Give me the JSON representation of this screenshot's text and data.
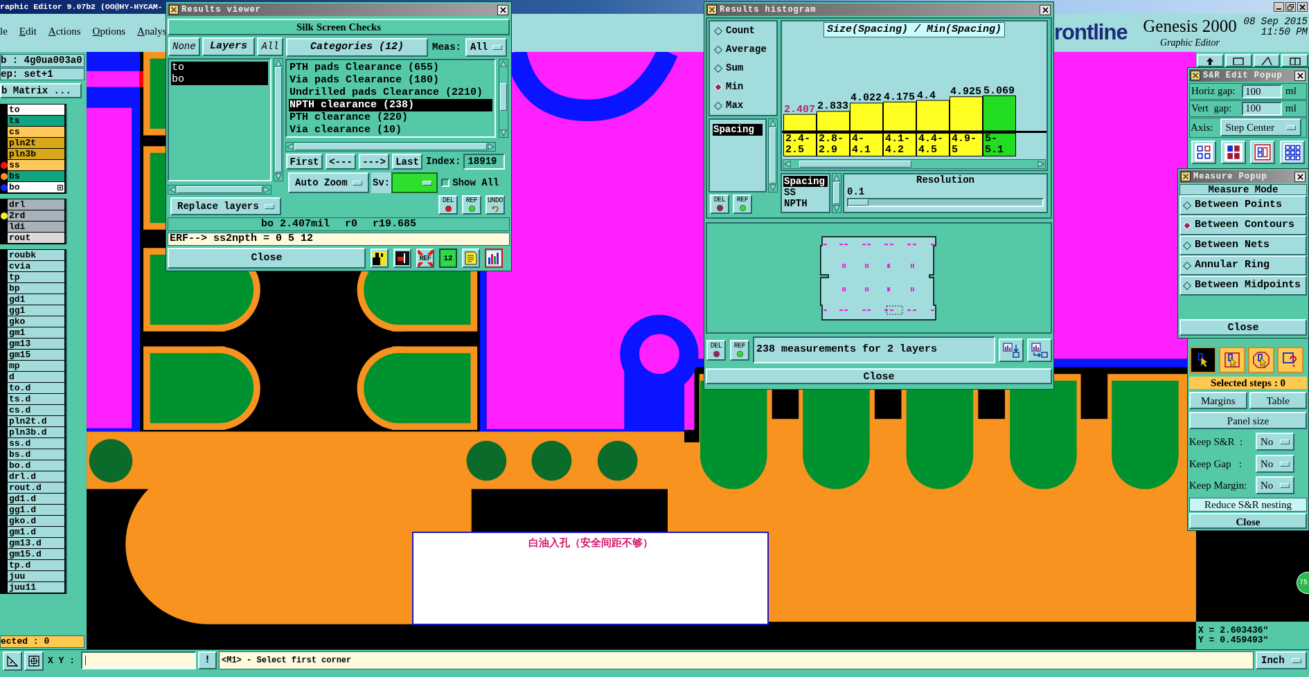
{
  "main_window": {
    "title": "raphic Editor 9.07b2 (OO@HY-HYCAM-",
    "menu": [
      {
        "label": "le",
        "mnemonic": false
      },
      {
        "label": "Edit",
        "mnemonic": true
      },
      {
        "label": "Actions",
        "mnemonic": true
      },
      {
        "label": "Options",
        "mnemonic": true
      },
      {
        "label": "Analys",
        "mnemonic": true
      }
    ]
  },
  "header": {
    "logo": "rontline",
    "product": "Genesis 2000",
    "subtitle": "Graphic Editor",
    "date": "08 Sep 2015",
    "time": "11:50 PM"
  },
  "left_panel": {
    "job": "b : 4g0ua003a0",
    "step": "ep: set+1",
    "matrix_button": "b Matrix ...",
    "layer_groups": [
      {
        "layers": [
          {
            "name": "to",
            "kind": "silk",
            "work": false
          },
          {
            "name": "ts",
            "kind": "mask",
            "work": false
          },
          {
            "name": "cs",
            "kind": "signal",
            "work": false
          },
          {
            "name": "pln2t",
            "kind": "plane",
            "work": false
          },
          {
            "name": "pln3b",
            "kind": "plane",
            "work": false
          },
          {
            "name": "ss",
            "kind": "signal",
            "work": false,
            "color": "#ff1010"
          },
          {
            "name": "bs",
            "kind": "mask",
            "work": false,
            "color": "#ff8c20"
          },
          {
            "name": "bo",
            "kind": "silk",
            "work": true,
            "color": "#0a28ff"
          }
        ]
      },
      {
        "layers": [
          {
            "name": "drl",
            "kind": "drill",
            "work": false
          },
          {
            "name": "2rd",
            "kind": "drill",
            "work": false,
            "color": "#f8f020"
          },
          {
            "name": "ldi",
            "kind": "drill",
            "work": false
          },
          {
            "name": "rout",
            "kind": "rout",
            "work": false
          }
        ]
      },
      {
        "layers": [
          {
            "name": "roubk",
            "kind": "misc",
            "work": false
          },
          {
            "name": "cvia",
            "kind": "misc",
            "work": false
          },
          {
            "name": "tp",
            "kind": "misc",
            "work": false
          },
          {
            "name": "bp",
            "kind": "misc",
            "work": false
          },
          {
            "name": "gd1",
            "kind": "misc",
            "work": false
          },
          {
            "name": "gg1",
            "kind": "misc",
            "work": false
          },
          {
            "name": "gko",
            "kind": "misc",
            "work": false
          },
          {
            "name": "gm1",
            "kind": "misc",
            "work": false
          },
          {
            "name": "gm13",
            "kind": "misc",
            "work": false
          },
          {
            "name": "gm15",
            "kind": "misc",
            "work": false
          },
          {
            "name": "mp",
            "kind": "misc",
            "work": false
          },
          {
            "name": "d",
            "kind": "misc",
            "work": false
          },
          {
            "name": "to.d",
            "kind": "misc",
            "work": false
          },
          {
            "name": "ts.d",
            "kind": "misc",
            "work": false
          },
          {
            "name": "cs.d",
            "kind": "misc",
            "work": false
          },
          {
            "name": "pln2t.d",
            "kind": "misc",
            "work": false
          },
          {
            "name": "pln3b.d",
            "kind": "misc",
            "work": false
          },
          {
            "name": "ss.d",
            "kind": "misc",
            "work": false
          },
          {
            "name": "bs.d",
            "kind": "misc",
            "work": false
          },
          {
            "name": "bo.d",
            "kind": "misc",
            "work": false
          },
          {
            "name": "drl.d",
            "kind": "misc",
            "work": false
          },
          {
            "name": "rout.d",
            "kind": "misc",
            "work": false
          },
          {
            "name": "gd1.d",
            "kind": "misc",
            "work": false
          },
          {
            "name": "gg1.d",
            "kind": "misc",
            "work": false
          },
          {
            "name": "gko.d",
            "kind": "misc",
            "work": false
          },
          {
            "name": "gm1.d",
            "kind": "misc",
            "work": false
          },
          {
            "name": "gm13.d",
            "kind": "misc",
            "work": false
          },
          {
            "name": "gm15.d",
            "kind": "misc",
            "work": false
          },
          {
            "name": "tp.d",
            "kind": "misc",
            "work": false
          },
          {
            "name": "juu",
            "kind": "misc",
            "work": false
          },
          {
            "name": "juu11",
            "kind": "misc",
            "work": false
          }
        ]
      }
    ],
    "selected_count": "ected : 0"
  },
  "canvas": {
    "note": "白油入孔（安全间距不够）",
    "badge": "75"
  },
  "right_strip": {
    "coordinates": [
      "X = 2.603436\"",
      "Y = 0.459493\""
    ]
  },
  "status_bar": {
    "xy_label": "X Y :",
    "confirm_button": "!",
    "message": "<M1> - Select first corner",
    "units": "Inch"
  },
  "results_viewer": {
    "title": "Results viewer",
    "heading": "Silk Screen Checks",
    "none_button": "None",
    "layers_label": "Layers",
    "all_button": "All",
    "layers": [
      {
        "name": "to",
        "selected": true
      },
      {
        "name": "bo",
        "selected": true
      }
    ],
    "layer_mode": "Replace layers",
    "categories_button": "Categories (12)",
    "meas_label": "Meas:",
    "meas_value": "All",
    "categories": [
      {
        "label": "PTH pads Clearance (655)",
        "selected": false
      },
      {
        "label": "Via pads Clearance (180)",
        "selected": false
      },
      {
        "label": "Undrilled pads Clearance (2210)",
        "selected": false
      },
      {
        "label": "NPTH clearance (238)",
        "selected": true
      },
      {
        "label": "PTH clearance (220)",
        "selected": false
      },
      {
        "label": "Via clearance (10)",
        "selected": false
      }
    ],
    "nav_buttons": [
      "First",
      "<---",
      "--->",
      "Last"
    ],
    "index_label": "Index:",
    "index_value": "18919",
    "zoom_mode": "Auto Zoom",
    "severity": {
      "label": "Sv:",
      "color": "#2ee02e"
    },
    "show_all": {
      "label": "Show All",
      "checked": false
    },
    "action_buttons": [
      "DEL",
      "REF",
      "UNDO"
    ],
    "info": [
      "bo 2.407mil",
      "r0",
      "r19.685"
    ],
    "command": "ERF--> ss2npth = 0 5 12",
    "close": "Close",
    "tool_buttons": [
      {
        "kind": "icon",
        "selected": false
      },
      {
        "kind": "icon",
        "selected": false
      },
      {
        "kind": "crossed",
        "label": "REF",
        "selected": false
      },
      {
        "kind": "tag",
        "label": "12",
        "selected": false
      },
      {
        "kind": "icon",
        "selected": false
      },
      {
        "kind": "icon",
        "selected": true
      }
    ]
  },
  "results_histogram": {
    "title": "Results histogram",
    "functions": [
      {
        "label": "Count",
        "selected": false
      },
      {
        "label": "Average",
        "selected": false
      },
      {
        "label": "Sum",
        "selected": false
      },
      {
        "label": "Min",
        "selected": true
      },
      {
        "label": "Max",
        "selected": false
      }
    ],
    "measures": [
      {
        "label": "Spacing",
        "selected": true
      }
    ],
    "side_buttons": [
      "DEL",
      "REF"
    ],
    "chart_data": {
      "type": "bar",
      "title": "Size(Spacing) / Min(Spacing)",
      "categories": [
        "2.4- 2.5",
        "2.8- 2.9",
        "4- 4.1",
        "4.1- 4.2",
        "4.4- 4.5",
        "4.9- 5",
        "5- 5.1"
      ],
      "values": [
        2.407,
        2.833,
        4.022,
        4.175,
        4.4,
        4.925,
        5.069
      ],
      "data_labels": true
    },
    "bars": [
      {
        "selected": true,
        "highlighted": false
      },
      {
        "selected": false,
        "highlighted": false
      },
      {
        "selected": false,
        "highlighted": false
      },
      {
        "selected": false,
        "highlighted": false
      },
      {
        "selected": false,
        "highlighted": false
      },
      {
        "selected": false,
        "highlighted": false
      },
      {
        "selected": false,
        "highlighted": true
      }
    ],
    "layers": [
      {
        "label": "Spacing",
        "selected": true
      },
      {
        "label": "SS",
        "selected": false
      },
      {
        "label": "NPTH",
        "selected": false
      }
    ],
    "resolution": {
      "label": "Resolution",
      "value": "0.1",
      "level": 0
    },
    "footer_buttons": [
      "DEL",
      "REF"
    ],
    "status": "238 measurements for 2 layers",
    "close": "Close"
  },
  "sr_popup": {
    "title": "S&R Edit Popup",
    "gaps": [
      {
        "label": "Horiz gap:",
        "value": "100",
        "unit": "ml"
      },
      {
        "label": "Vert  gap:",
        "value": "100",
        "unit": "ml"
      }
    ],
    "axis": {
      "label": "Axis:",
      "value": "Step Center"
    },
    "cursor_tools": [
      {
        "selected": true
      },
      {
        "selected": false
      },
      {
        "selected": false
      },
      {
        "selected": false
      }
    ],
    "selected_steps": "Selected steps : 0",
    "buttons": [
      "Margins",
      "Table"
    ],
    "panel_size": "Panel size",
    "keep_options": [
      {
        "label": "Keep S&R  :",
        "value": "No"
      },
      {
        "label": "Keep Gap   :",
        "value": "No"
      },
      {
        "label": "Keep Margin:",
        "value": "No"
      }
    ],
    "reduce_nesting": "Reduce S&R nesting",
    "close": "Close"
  },
  "measure_popup": {
    "title": "Measure Popup",
    "heading": "Measure Mode",
    "modes": [
      {
        "label": "Between Points",
        "selected": false
      },
      {
        "label": "Between Contours",
        "selected": true
      },
      {
        "label": "Between Nets",
        "selected": false
      },
      {
        "label": "Annular Ring",
        "selected": false
      },
      {
        "label": "Between Midpoints",
        "selected": false
      }
    ],
    "close": "Close"
  }
}
